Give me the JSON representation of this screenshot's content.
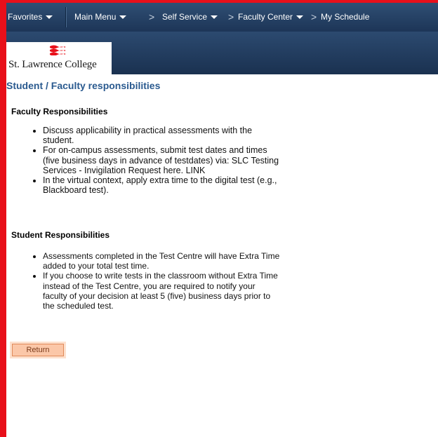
{
  "nav": {
    "favorites": "Favorites",
    "main_menu": "Main Menu",
    "separator": ">",
    "breadcrumb": {
      "self_service": "Self Service",
      "faculty_center": "Faculty Center",
      "my_schedule": "My Schedule"
    }
  },
  "banner": {
    "logo_text": "St. Lawrence College",
    "logo_icon": "slc-wave-logo-icon"
  },
  "page": {
    "title": "Student / Faculty responsibilities",
    "faculty": {
      "heading": "Faculty Responsibilities",
      "items": [
        "Discuss applicability in practical assessments with the student.",
        "For on-campus assessments, submit test dates and times (five business days in advance of testdates) via: SLC Testing Services - Invigilation Request here. LINK",
        "In the virtual context, apply extra time to the digital test (e.g., Blackboard test)."
      ]
    },
    "student": {
      "heading": "Student Responsibilities",
      "items": [
        "Assessments completed in the Test Centre will have Extra Time added to your total test time.",
        "If you choose to write tests in the classroom without Extra Time instead of the Test Centre, you are required to notify your faculty of your decision at least 5 (five) business days prior to the scheduled test."
      ]
    },
    "return_label": "Return"
  },
  "colors": {
    "frame_border": "#e8101a",
    "nav_background": "#1d3557",
    "title_color": "#2a5a8f",
    "return_button": "#fbc7a8",
    "logo_red": "#e8101a"
  }
}
